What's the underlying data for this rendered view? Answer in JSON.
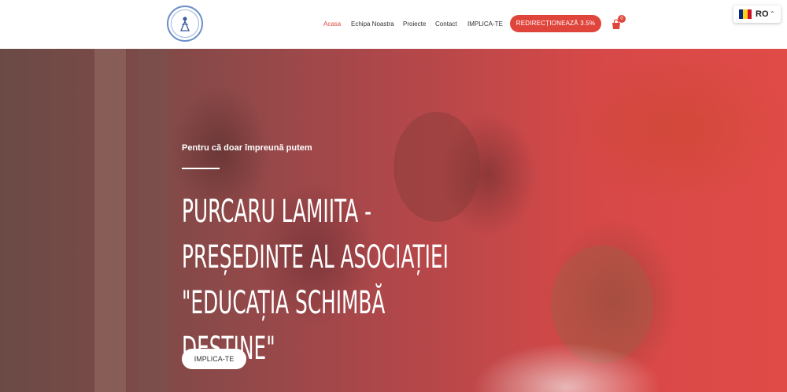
{
  "header": {
    "nav": [
      {
        "label": "Acasa",
        "active": true
      },
      {
        "label": "Echipa Noastra",
        "active": false
      },
      {
        "label": "Proiecte",
        "active": false
      },
      {
        "label": "Contact",
        "active": false
      },
      {
        "label": "IMPLICA-TE",
        "active": false
      }
    ],
    "redirect_button": "REDIRECȚIONEAZĂ 3.5%",
    "cart_icon": "shopping-bag-icon",
    "cart_count": "0",
    "language": {
      "code": "RO",
      "flag_icon": "romania-flag-icon",
      "caret_icon": "chevron-up-icon"
    }
  },
  "hero": {
    "subtitle": "Pentru că doar împreună putem",
    "headline": "Purcaru Lamiita - Președinte al asociației \"Educația schimbă destine\"",
    "cta_label": "IMPLICA-TE"
  },
  "colors": {
    "accent": "#e0453c",
    "text": "#333333",
    "flag_blue": "#002b7f",
    "flag_yellow": "#fcd116",
    "flag_red": "#ce1126"
  }
}
